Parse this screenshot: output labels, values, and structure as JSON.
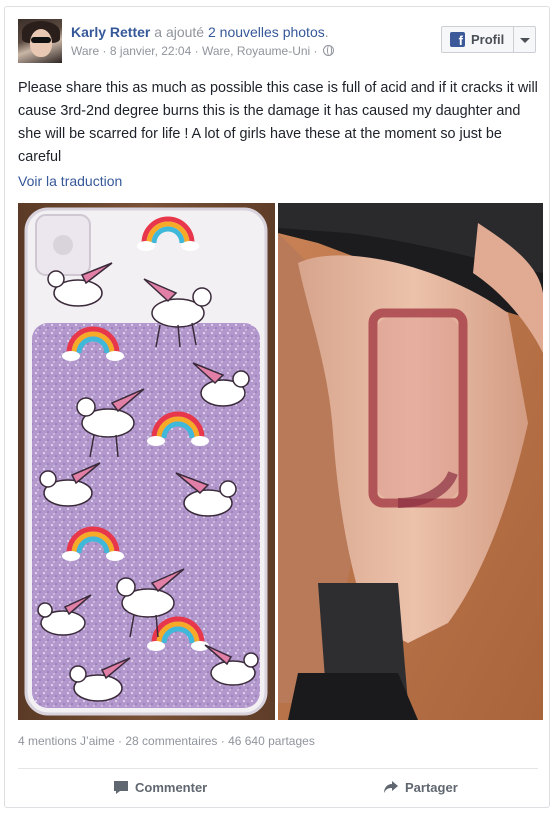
{
  "post": {
    "author": "Karly Retter",
    "action_prefix": "a ajouté",
    "action_link": "2 nouvelles photos",
    "action_suffix": ".",
    "meta": "Ware · 8 janvier, 22:04 · Ware, Royaume-Uni ·",
    "text": "Please share this as much as possible this case is full of acid and if it cracks it will cause 3rd-2nd degree burns this is the damage it has caused my daughter and she will be scarred for life ! A lot of girls have these at the moment so just be careful",
    "translate_label": "Voir la traduction",
    "stats": "4 mentions J’aime · 28 commentaires · 46 640 partages"
  },
  "profile_button": {
    "label": "Profil"
  },
  "actions": {
    "comment_label": "Commenter",
    "share_label": "Partager"
  },
  "icons": {
    "facebook": "facebook-f-icon",
    "globe": "globe-icon",
    "dropdown": "chevron-down-icon",
    "comment": "comment-bubble-icon",
    "share": "share-arrow-icon"
  },
  "colors": {
    "link": "#365899",
    "meta": "#90949c",
    "fb_blue": "#3b5998",
    "border": "#dddfe2"
  }
}
